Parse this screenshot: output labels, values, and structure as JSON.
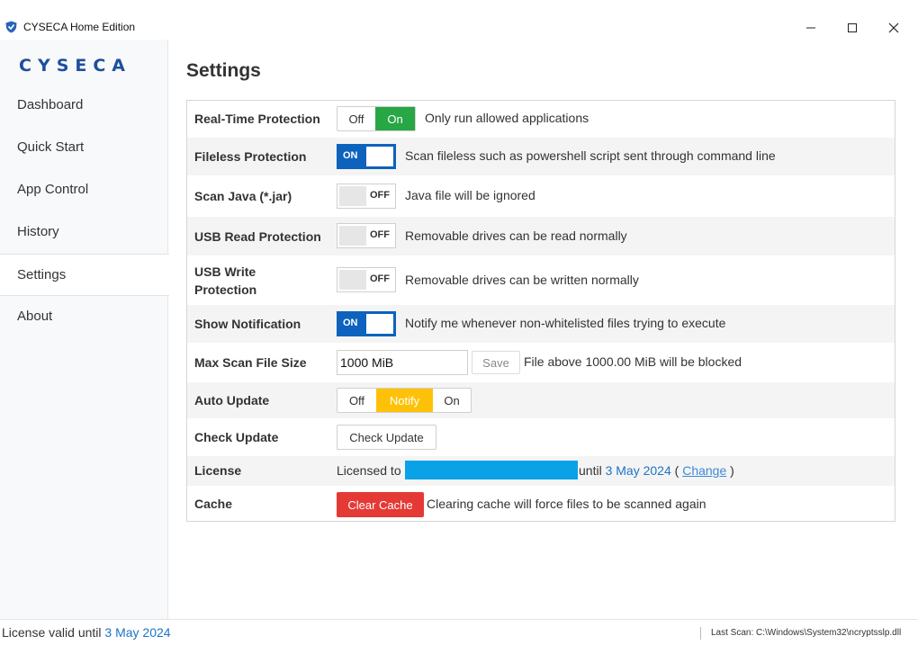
{
  "window": {
    "title": "CYSECA Home Edition",
    "minimize_glyph": "─",
    "maximize_glyph": "☐",
    "close_glyph": "✕"
  },
  "sidebar": {
    "logo": "CYSECA",
    "items": [
      {
        "label": "Dashboard"
      },
      {
        "label": "Quick Start"
      },
      {
        "label": "App Control"
      },
      {
        "label": "History"
      },
      {
        "label": "Settings"
      },
      {
        "label": "About"
      }
    ],
    "active": "Settings"
  },
  "page": {
    "title": "Settings"
  },
  "settings": {
    "realtime": {
      "label": "Real-Time Protection",
      "off": "Off",
      "on": "On",
      "selected": "On",
      "desc": "Only run allowed applications"
    },
    "fileless": {
      "label": "Fileless Protection",
      "state": "ON",
      "desc": "Scan fileless such as powershell script sent through command line"
    },
    "java": {
      "label": "Scan Java (*.jar)",
      "state": "OFF",
      "desc": "Java file will be ignored"
    },
    "usb_read": {
      "label": "USB Read Protection",
      "state": "OFF",
      "desc": "Removable drives can be read normally"
    },
    "usb_write": {
      "label_line1": "USB Write",
      "label_line2": "Protection",
      "state": "OFF",
      "desc": "Removable drives can be written normally"
    },
    "notification": {
      "label": "Show Notification",
      "state": "ON",
      "desc": "Notify me whenever non-whitelisted files trying to execute"
    },
    "max_size": {
      "label": "Max Scan File Size",
      "value": "1000 MiB",
      "save": "Save",
      "desc": "File above 1000.00 MiB will be blocked"
    },
    "auto_update": {
      "label": "Auto Update",
      "off": "Off",
      "notify": "Notify",
      "on": "On",
      "selected": "Notify"
    },
    "check_update": {
      "label": "Check Update",
      "button": "Check Update"
    },
    "license": {
      "label": "License",
      "prefix": "Licensed to",
      "until": "until",
      "date": "3 May 2024",
      "open_paren": "(",
      "change": "Change",
      "close_paren": ")"
    },
    "cache": {
      "label": "Cache",
      "button": "Clear Cache",
      "desc": "Clearing cache will force files to be scanned again"
    }
  },
  "status": {
    "license_prefix": "License valid until",
    "license_date": "3 May 2024",
    "last_scan": "Last Scan: C:\\Windows\\System32\\ncryptsslp.dll"
  },
  "colors": {
    "accent_blue": "#0d62bd",
    "green": "#28a745",
    "yellow": "#ffc107",
    "red": "#e53935",
    "redaction": "#0aa2e6",
    "logo": "#1d4f9c"
  }
}
